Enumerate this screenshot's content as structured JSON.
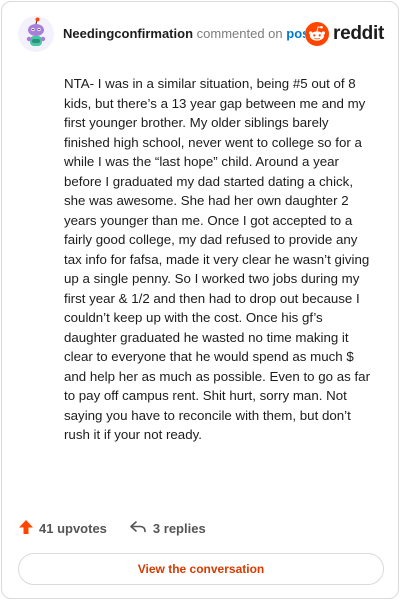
{
  "header": {
    "username": "Needingconfirmation",
    "commented": "commented on",
    "post_link": "post",
    "brand_word": "reddit",
    "avatar_icon": "snoo-avatar-icon",
    "brand_icon": "reddit-snoo-icon",
    "colors": {
      "link": "#0079d3",
      "brand": "#ff4500",
      "muted": "#7c7c7c"
    }
  },
  "comment": {
    "body": "NTA- I was in a similar situation, being #5 out of 8 kids, but there’s a 13 year gap between me and my first younger brother. My older siblings barely finished high school, never went to college so for a while I was the “last hope” child. Around a year before I graduated my dad started dating a chick, she was awesome. She had her own daughter 2 years younger than me. Once I got accepted to a fairly good college, my dad refused to provide any tax info for fafsa, made it very clear he wasn’t giving up a single penny. So I worked two jobs during my first year & 1/2 and then had to drop out because I couldn’t keep up with the cost. Once his gf’s daughter graduated he wasted no time making it clear to everyone that he would spend as much $ and help her as much as possible. Even to go as far to pay off campus rent. Shit hurt, sorry man. Not saying you have to reconcile with them, but don’t rush it if your not ready."
  },
  "footer": {
    "upvotes": "41 upvotes",
    "replies": "3 replies",
    "upvote_icon": "upvote-arrow-icon",
    "reply_icon": "reply-arrow-icon",
    "colors": {
      "upvote": "#ff4500"
    }
  },
  "actions": {
    "view_conversation": "View the conversation",
    "colors": {
      "button_text": "#d93a00"
    }
  }
}
